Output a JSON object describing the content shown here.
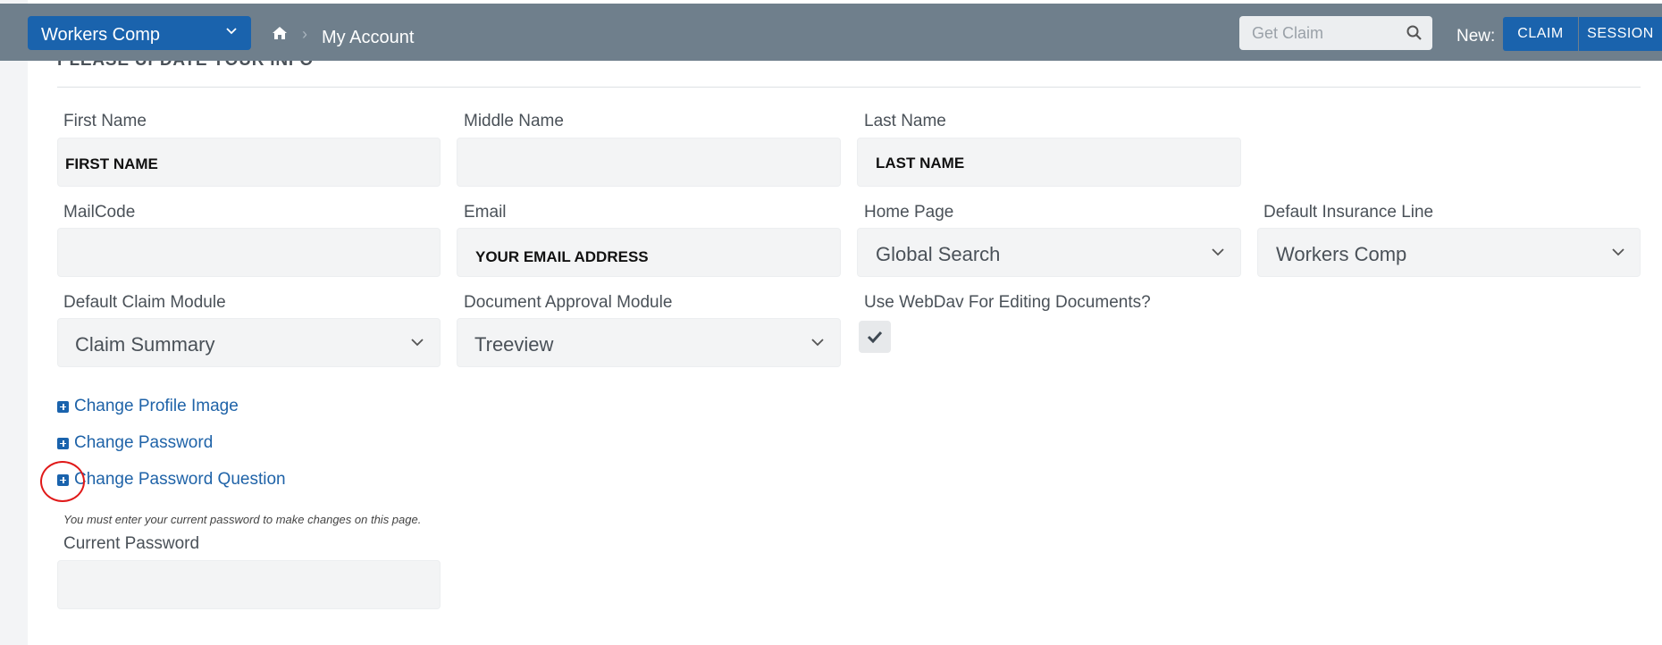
{
  "header": {
    "line_of_business": "Workers Comp",
    "breadcrumb_page": "My Account",
    "search_placeholder": "Get Claim",
    "new_label": "New:",
    "new_claim_label": "CLAIM",
    "new_session_label": "SESSION"
  },
  "section": {
    "title": "PLEASE UPDATE YOUR INFO"
  },
  "fields": {
    "first_name": {
      "label": "First Name",
      "value": "FIRST NAME"
    },
    "middle_name": {
      "label": "Middle Name",
      "value": ""
    },
    "last_name": {
      "label": "Last Name",
      "value": "LAST NAME"
    },
    "mail_code": {
      "label": "MailCode",
      "value": ""
    },
    "email": {
      "label": "Email",
      "value": "YOUR EMAIL ADDRESS"
    },
    "home_page": {
      "label": "Home Page",
      "value": "Global Search"
    },
    "default_insurance_line": {
      "label": "Default Insurance Line",
      "value": "Workers Comp"
    },
    "default_claim_module": {
      "label": "Default Claim Module",
      "value": "Claim Summary"
    },
    "document_approval_module": {
      "label": "Document Approval Module",
      "value": "Treeview"
    },
    "use_webdav": {
      "label": "Use WebDav For Editing Documents?",
      "checked": true
    },
    "current_password": {
      "label": "Current Password",
      "value": ""
    }
  },
  "toggles": [
    {
      "label": "Change Profile Image"
    },
    {
      "label": "Change Password"
    },
    {
      "label": "Change Password Question"
    }
  ],
  "note": "You must enter your current password to make changes on this page.",
  "colors": {
    "topbar": "#6f7f8c",
    "primary": "#1a63ad",
    "link": "#1f63a8",
    "annotation": "#e01919"
  }
}
